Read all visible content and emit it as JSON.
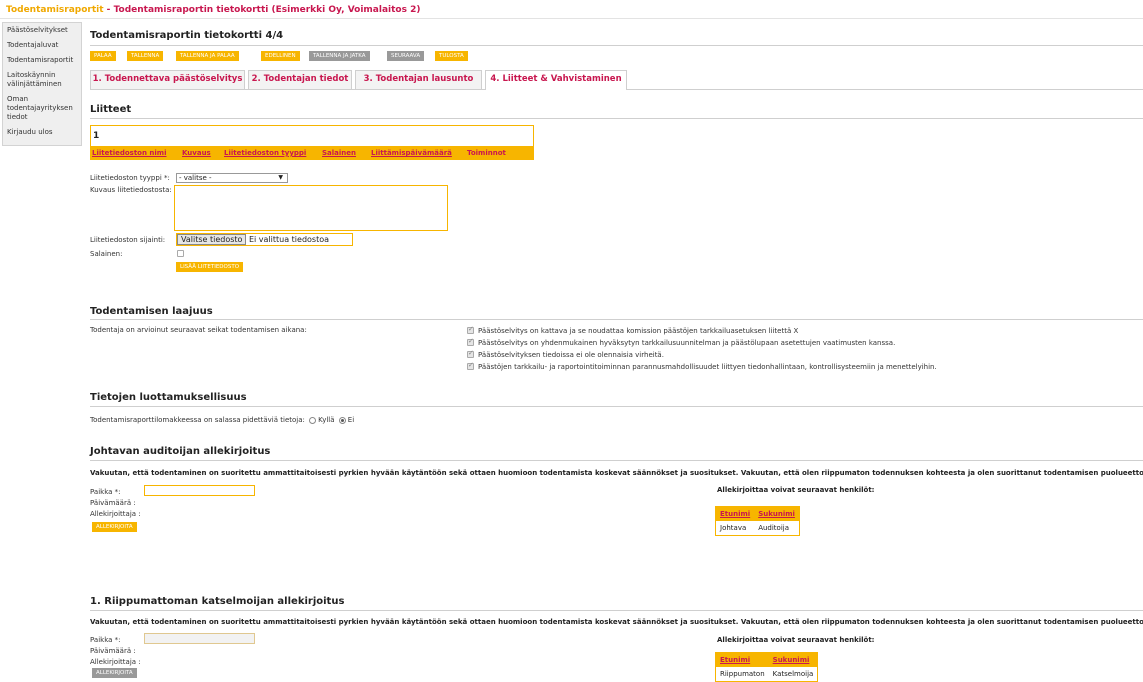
{
  "breadcrumb": {
    "root": "Todentamisraportit",
    "separator": " - ",
    "current": "Todentamisraportin tietokortti (Esimerkki Oy, Voimalaitos 2)"
  },
  "sidebar": {
    "items": [
      {
        "label": "Päästöselvitykset"
      },
      {
        "label": "Todentajaluvat"
      },
      {
        "label": "Todentamisraportit"
      },
      {
        "label": "Laitoskäynnin välinjättäminen"
      },
      {
        "label": "Oman todentajayrityksen tiedot"
      },
      {
        "label": "Kirjaudu ulos"
      }
    ]
  },
  "page": {
    "title": "Todentamisraportin tietokortti 4/4"
  },
  "toolbar": {
    "buttons": [
      {
        "label": "PALAA"
      },
      {
        "label": "TALLENNA"
      },
      {
        "label": "TALLENNA JA PALAA"
      },
      {
        "label": "EDELLINEN"
      },
      {
        "label": "TALLENNA JA JATKA"
      },
      {
        "label": "SEURAAVA"
      },
      {
        "label": "TULOSTA"
      }
    ]
  },
  "tabs": [
    {
      "label": "1. Todennettava päästöselvitys"
    },
    {
      "label": "2. Todentajan tiedot"
    },
    {
      "label": "3. Todentajan lausunto"
    },
    {
      "label": "4. Liitteet & Vahvistaminen"
    }
  ],
  "attachments": {
    "title": "Liitteet",
    "row_number": "1",
    "columns": [
      "Liitetiedoston nimi",
      "Kuvaus",
      "Liitetiedoston tyyppi",
      "Salainen",
      "Liittämispäivämäärä",
      "Toiminnot"
    ],
    "type_label": "Liitetiedoston tyyppi *:",
    "type_value": "- valitse -",
    "description_label": "Kuvaus liitetiedostosta:",
    "location_label": "Liitetiedoston sijainti:",
    "file_button": "Valitse tiedosto",
    "file_status": "Ei valittua tiedostoa",
    "secret_label": "Salainen:",
    "add_button": "LISÄÄ LIITETIEDOSTO"
  },
  "scope": {
    "title": "Todentamisen laajuus",
    "intro": "Todentaja on arvioinut seuraavat seikat todentamisen aikana:",
    "items": [
      {
        "label": "Päästöselvitys on kattava ja se noudattaa komission päästöjen tarkkailuasetuksen liitettä X",
        "checked": true
      },
      {
        "label": "Päästöselvitys on yhdenmukainen hyväksytyn tarkkailusuunnitelman ja päästölupaan asetettujen vaatimusten kanssa.",
        "checked": true
      },
      {
        "label": "Päästöselvityksen tiedoissa ei ole olennaisia virheitä.",
        "checked": true
      },
      {
        "label": "Päästöjen tarkkailu- ja raportointitoiminnan parannusmahdollisuudet liittyen tiedonhallintaan, kontrollisysteemiin ja menettelyihin.",
        "checked": true
      }
    ]
  },
  "confidentiality": {
    "title": "Tietojen luottamuksellisuus",
    "question": "Todentamisraporttilomakkeessa on salassa pidettäviä tietoja:",
    "option_yes": "Kyllä",
    "option_no": "Ei",
    "selected": "Ei"
  },
  "signature_sections": [
    {
      "title": "Johtavan auditoijan allekirjoitus",
      "statement": "Vakuutan, että todentaminen on suoritettu ammattitaitoisesti pyrkien hyvään käytäntöön sekä ottaen huomioon todentamista koskevat säännökset ja suositukset. Vakuutan, että olen riippumaton todennuksen kohteesta ja olen suorittanut todentamisen puolueettomasti.",
      "place_label": "Paikka *:",
      "date_label": "Päivämäärä :",
      "signer_label": "Allekirjoittaja :",
      "sign_button": "ALLEKIRJOITA",
      "signers_title": "Allekirjoittaa voivat seuraavat henkilöt:",
      "columns": [
        "Etunimi",
        "Sukunimi"
      ],
      "rows": [
        [
          "Johtava",
          "Auditoija"
        ]
      ]
    },
    {
      "title": "1. Riippumattoman katselmoijan allekirjoitus",
      "statement": "Vakuutan, että todentaminen on suoritettu ammattitaitoisesti pyrkien hyvään käytäntöön sekä ottaen huomioon todentamista koskevat säännökset ja suositukset. Vakuutan, että olen riippumaton todennuksen kohteesta ja olen suorittanut todentamisen puolueettomasti.",
      "place_label": "Paikka *:",
      "date_label": "Päivämäärä :",
      "signer_label": "Allekirjoittaja :",
      "sign_button": "ALLEKIRJOITA",
      "signers_title": "Allekirjoittaa voivat seuraavat henkilöt:",
      "columns": [
        "Etunimi",
        "Sukunimi"
      ],
      "rows": [
        [
          "Riippumaton",
          "Katselmoija"
        ]
      ]
    }
  ],
  "colors": {
    "accent": "#f7b500",
    "brand": "#c8174f",
    "disabled_button": "#999999"
  }
}
